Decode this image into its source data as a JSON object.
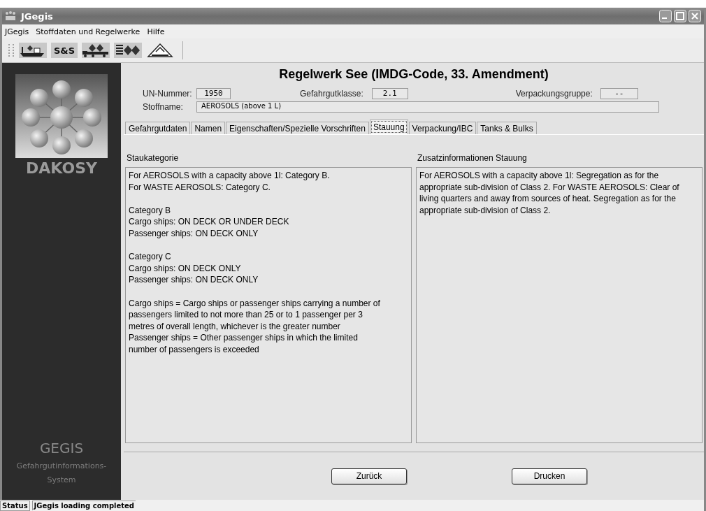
{
  "window": {
    "title": "JGegis"
  },
  "menu": [
    {
      "label": "JGegis"
    },
    {
      "label": "Stoffdaten und Regelwerke"
    },
    {
      "label": "Hilfe"
    }
  ],
  "toolbar": [
    {
      "kind": "ship"
    },
    {
      "kind": "text",
      "label": "S&S"
    },
    {
      "kind": "truck"
    },
    {
      "kind": "list"
    },
    {
      "kind": "triangle"
    }
  ],
  "sidebar": {
    "brand": "DAKOSY",
    "product": "GEGIS",
    "subtitle": [
      "Gefahrgutinformations-",
      "System"
    ]
  },
  "heading": "Regelwerk See (IMDG-Code, 33. Amendment)",
  "fields": {
    "un_label": "UN-Nummer:",
    "un_value": "1950",
    "class_label": "Gefahrgutklasse:",
    "class_value": "2.1",
    "pg_label": "Verpackungsgruppe:",
    "pg_value": "--",
    "name_label": "Stoffname:",
    "name_value": "AEROSOLS (above 1 L)"
  },
  "tabs": [
    {
      "label": "Gefahrgutdaten",
      "selected": false
    },
    {
      "label": "Namen",
      "selected": false
    },
    {
      "label": "Eigenschaften/Spezielle Vorschriften",
      "selected": false
    },
    {
      "label": "Stauung",
      "selected": true
    },
    {
      "label": "Verpackung/IBC",
      "selected": false
    },
    {
      "label": "Tanks & Bulks",
      "selected": false
    }
  ],
  "panels": [
    {
      "title": "Staukategorie",
      "paragraphs": [
        [
          "For AEROSOLS with a capacity above 1l: Category B.",
          "For WASTE AEROSOLS: Category C."
        ],
        [
          "Category B",
          "Cargo ships: ON DECK OR UNDER DECK",
          "Passenger ships: ON DECK ONLY"
        ],
        [
          "Category C",
          "Cargo ships: ON DECK ONLY",
          "Passenger ships: ON DECK ONLY"
        ],
        [
          "Cargo ships = Cargo ships or passenger ships carrying a number of",
          "passengers limited to not more than 25 or to 1 passenger per 3",
          "metres of overall length, whichever is the greater number",
          "Passenger ships = Other passenger ships in which the limited",
          "number of passengers is exceeded"
        ]
      ]
    },
    {
      "title": "Zusatzinformationen Stauung",
      "paragraphs": [
        [
          "For AEROSOLS with a capacity above 1l: Segregation as for the",
          "appropriate sub-division of Class 2.  For WASTE AEROSOLS: Clear of",
          "living quarters and away from sources of heat. Segregation as for the",
          "appropriate sub-division of Class 2."
        ]
      ]
    }
  ],
  "buttons": [
    "Zurück",
    "Drucken"
  ],
  "status_bar": {
    "label": "Status",
    "message": "JGegis loading completed"
  }
}
